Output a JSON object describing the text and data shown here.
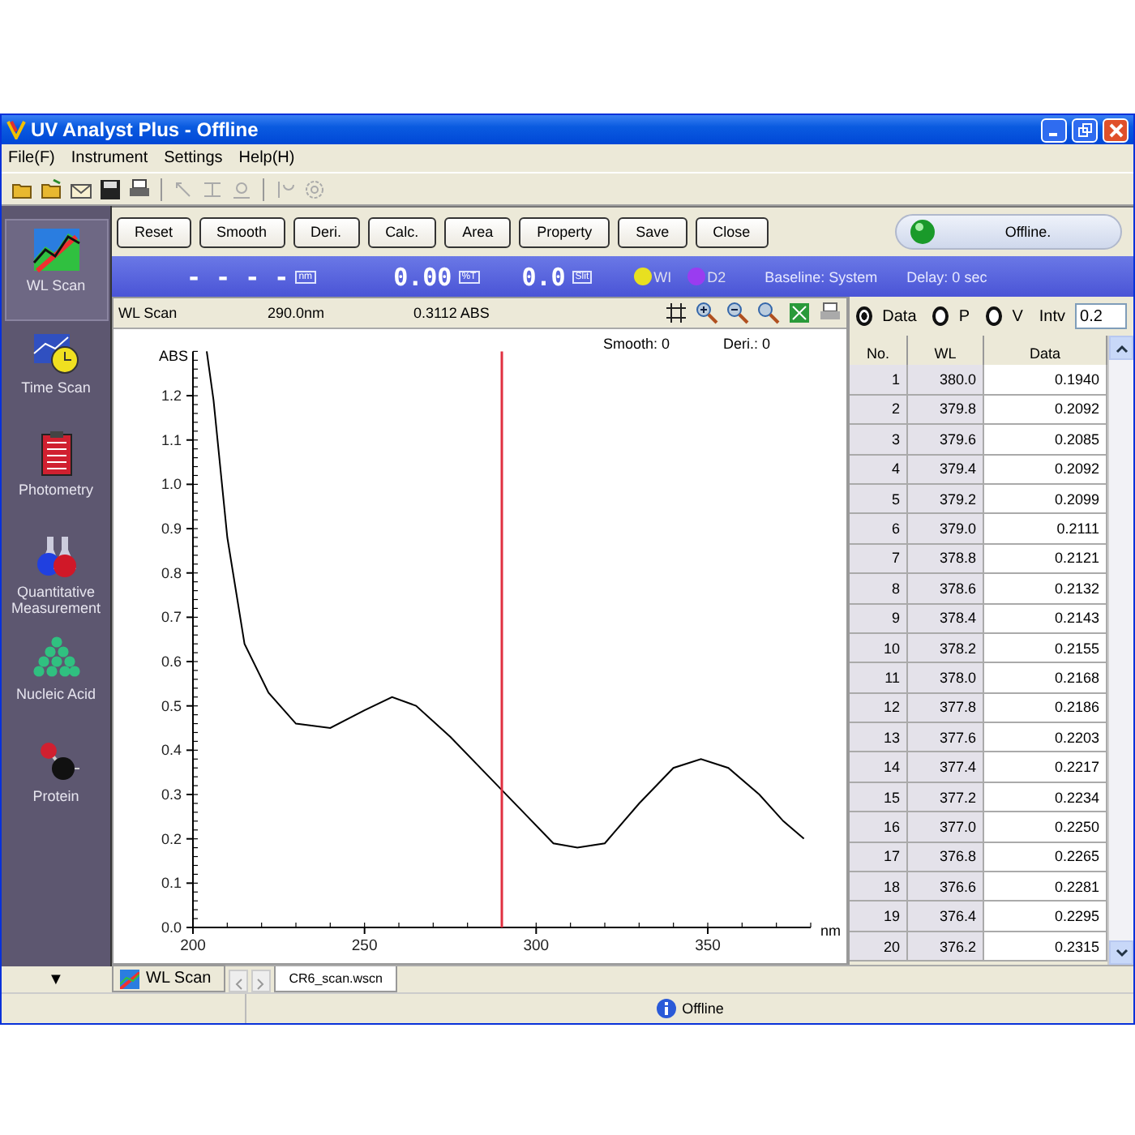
{
  "window": {
    "title": "UV Analyst Plus - Offline"
  },
  "menu": [
    "File(F)",
    "Instrument",
    "Settings",
    "Help(H)"
  ],
  "sidebar": {
    "items": [
      {
        "label": "WL Scan",
        "selected": true
      },
      {
        "label": "Time Scan",
        "selected": false
      },
      {
        "label": "Photometry",
        "selected": false
      },
      {
        "label": "Quantitative Measurement",
        "selected": false
      },
      {
        "label": "Nucleic Acid",
        "selected": false
      },
      {
        "label": "Protein",
        "selected": false
      }
    ],
    "scroll_button": "▼"
  },
  "action_buttons": [
    "Reset",
    "Smooth",
    "Deri.",
    "Calc.",
    "Area",
    "Property",
    "Save",
    "Close"
  ],
  "status_indicator": {
    "label": "Offline."
  },
  "readout": {
    "wavelength": "- - - -",
    "wavelength_unit": "nm",
    "transmittance": "0.00",
    "transmittance_unit": "%T",
    "slit": "0.0",
    "slit_unit": "Slit",
    "lamps": [
      {
        "label": "WI",
        "color": "#e8e020"
      },
      {
        "label": "D2",
        "color": "#9a3cf0"
      }
    ],
    "baseline": "Baseline: System",
    "delay": "Delay: 0 sec"
  },
  "chart_panel": {
    "title": "WL Scan",
    "cursor_wl": "290.0nm",
    "cursor_abs": "0.3112 ABS",
    "smooth": "Smooth: 0",
    "deri": "Deri.: 0",
    "chart_data": {
      "type": "line",
      "xlabel": "nm",
      "ylabel": "ABS",
      "xlim": [
        200,
        380
      ],
      "ylim": [
        0,
        1.3
      ],
      "xticks": [
        200,
        250,
        300,
        350
      ],
      "yticks": [
        {
          "value": 0,
          "label": "0.0"
        },
        {
          "value": 0.1,
          "label": "0.1"
        },
        {
          "value": 0.2,
          "label": "0.2"
        },
        {
          "value": 0.3,
          "label": "0.3"
        },
        {
          "value": 0.4,
          "label": "0.4"
        },
        {
          "value": 0.5,
          "label": "0.5"
        },
        {
          "value": 0.6,
          "label": "0.6"
        },
        {
          "value": 0.7,
          "label": "0.7"
        },
        {
          "value": 0.8,
          "label": "0.8"
        },
        {
          "value": 0.9,
          "label": "0.9"
        },
        {
          "value": 1.0,
          "label": "1.0"
        },
        {
          "value": 1.1,
          "label": "1.1"
        },
        {
          "value": 1.2,
          "label": "1.2"
        }
      ],
      "x": [
        204,
        206,
        210,
        215,
        222,
        230,
        240,
        250,
        258,
        265,
        275,
        285,
        295,
        305,
        312,
        320,
        330,
        340,
        348,
        356,
        365,
        372,
        378
      ],
      "series": [
        {
          "color": "#000000",
          "values": [
            1.3,
            1.19,
            0.88,
            0.64,
            0.53,
            0.46,
            0.45,
            0.49,
            0.52,
            0.5,
            0.43,
            0.35,
            0.27,
            0.19,
            0.18,
            0.19,
            0.28,
            0.36,
            0.38,
            0.36,
            0.3,
            0.24,
            0.2
          ]
        }
      ],
      "ref_lines": [
        {
          "axis": "x",
          "value": 290
        }
      ]
    }
  },
  "data_panel": {
    "modes": [
      {
        "label": "Data",
        "selected": true
      },
      {
        "label": "P",
        "selected": false
      },
      {
        "label": "V",
        "selected": false
      }
    ],
    "interval_label": "Intv",
    "interval": "0.2",
    "columns": [
      "No.",
      "WL",
      "Data"
    ],
    "rows": [
      [
        "1",
        "380.0",
        "0.1940"
      ],
      [
        "2",
        "379.8",
        "0.2092"
      ],
      [
        "3",
        "379.6",
        "0.2085"
      ],
      [
        "4",
        "379.4",
        "0.2092"
      ],
      [
        "5",
        "379.2",
        "0.2099"
      ],
      [
        "6",
        "379.0",
        "0.2111"
      ],
      [
        "7",
        "378.8",
        "0.2121"
      ],
      [
        "8",
        "378.6",
        "0.2132"
      ],
      [
        "9",
        "378.4",
        "0.2143"
      ],
      [
        "10",
        "378.2",
        "0.2155"
      ],
      [
        "11",
        "378.0",
        "0.2168"
      ],
      [
        "12",
        "377.8",
        "0.2186"
      ],
      [
        "13",
        "377.6",
        "0.2203"
      ],
      [
        "14",
        "377.4",
        "0.2217"
      ],
      [
        "15",
        "377.2",
        "0.2234"
      ],
      [
        "16",
        "377.0",
        "0.2250"
      ],
      [
        "17",
        "376.8",
        "0.2265"
      ],
      [
        "18",
        "376.6",
        "0.2281"
      ],
      [
        "19",
        "376.4",
        "0.2295"
      ],
      [
        "20",
        "376.2",
        "0.2315"
      ]
    ]
  },
  "tabs": [
    {
      "label": "WL Scan"
    }
  ],
  "document_tab": "CR6_scan.wscn",
  "status_bar": {
    "text": "Offline"
  }
}
